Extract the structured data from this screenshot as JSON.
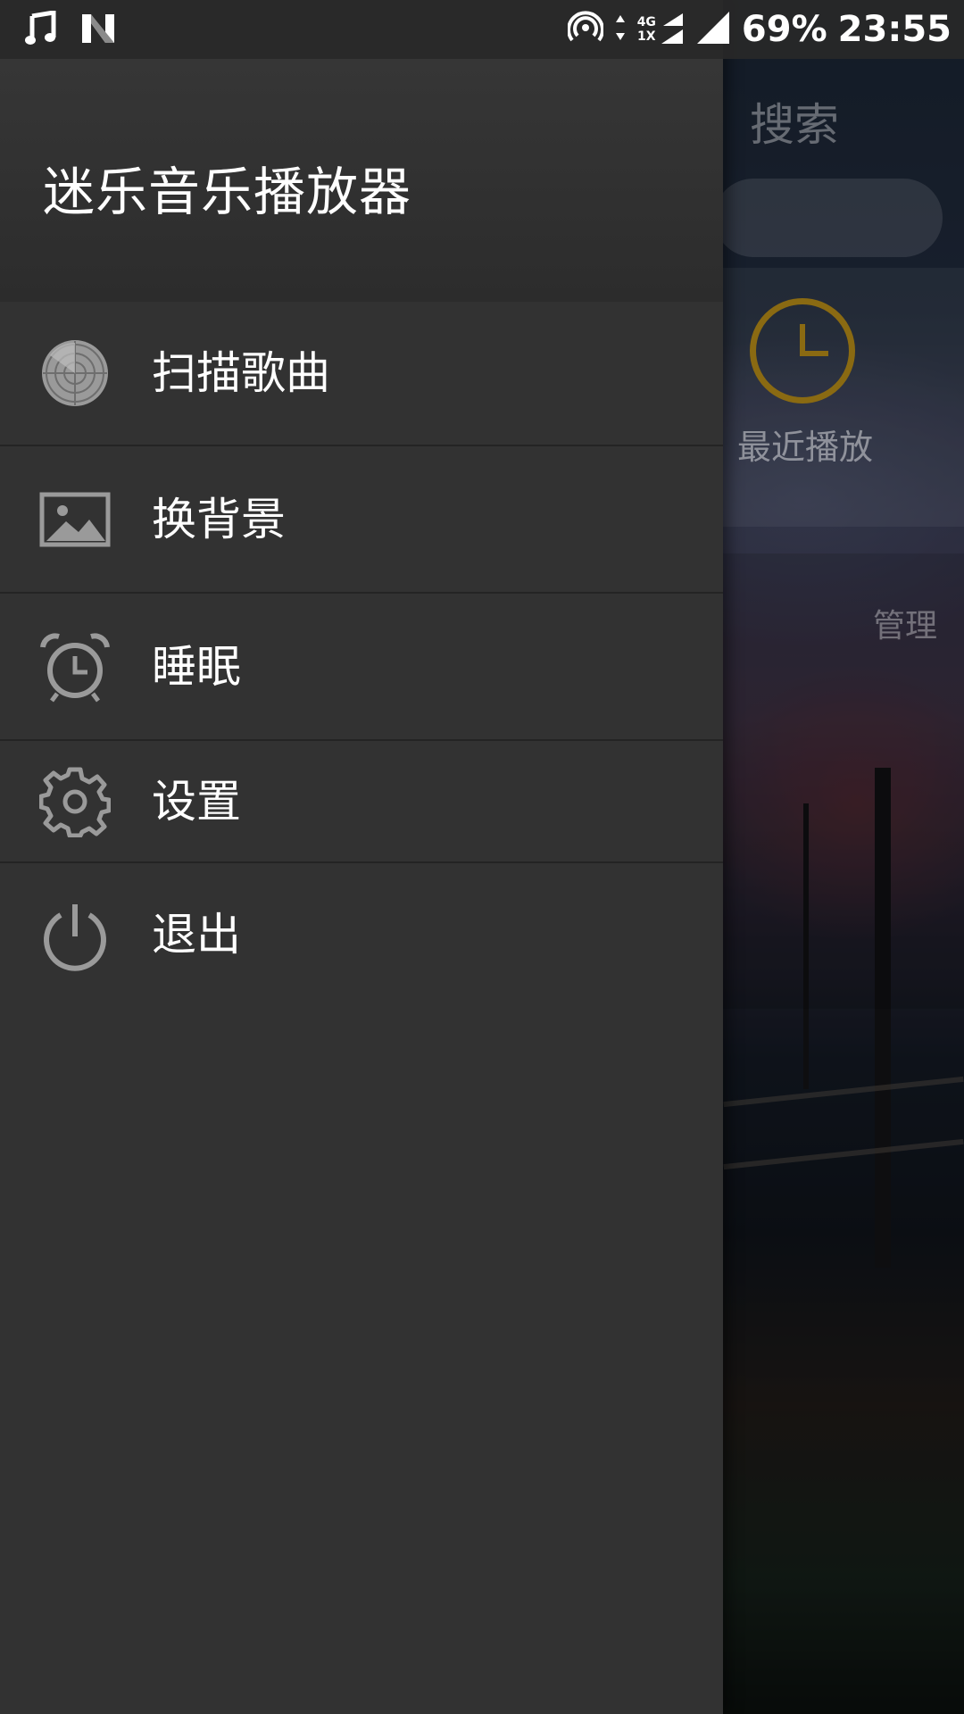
{
  "status_bar": {
    "battery": "69%",
    "time": "23:55",
    "network_top": "4G",
    "network_bottom": "1X",
    "icons": [
      "music-note-icon",
      "n-icon",
      "hotspot-icon",
      "data-arrows-icon",
      "signal-icon",
      "signal-full-icon"
    ]
  },
  "drawer": {
    "title": "迷乐音乐播放器",
    "items": [
      {
        "label": "扫描歌曲",
        "icon": "radar-scan-icon"
      },
      {
        "label": "换背景",
        "icon": "image-icon"
      },
      {
        "label": "睡眠",
        "icon": "alarm-clock-icon"
      },
      {
        "label": "设置",
        "icon": "gear-icon"
      },
      {
        "label": "退出",
        "icon": "power-icon"
      }
    ],
    "background_color": "#323232"
  },
  "background_app": {
    "search_title": "搜索",
    "recent_label": "最近播放",
    "manage_label": "管理",
    "accent_color": "#8a6a12"
  }
}
